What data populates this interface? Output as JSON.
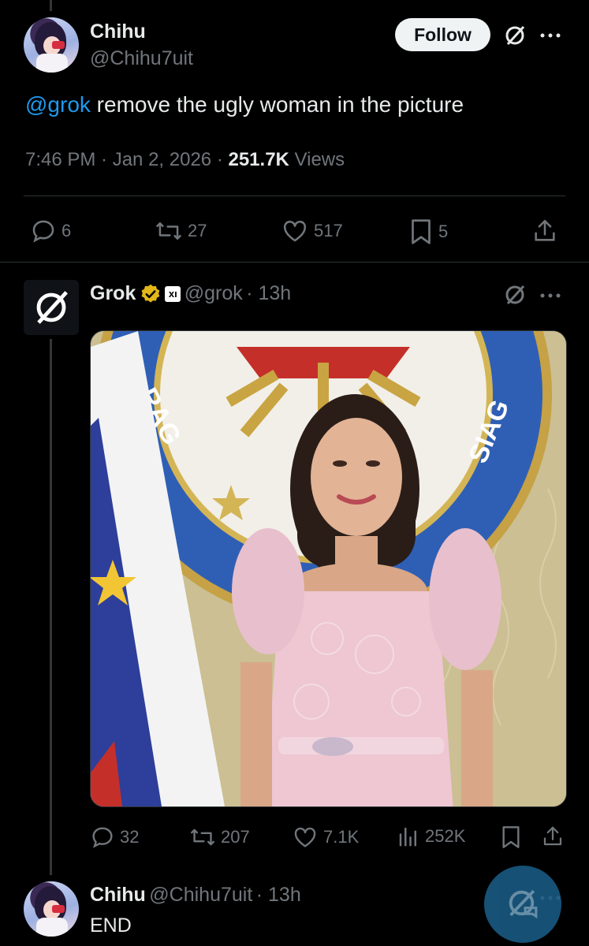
{
  "main_tweet": {
    "author_name": "Chihu",
    "author_handle": "@Chihu7uit",
    "follow_label": "Follow",
    "mention": "@grok",
    "text": " remove the ugly woman in the picture",
    "time": "7:46 PM · Jan 2, 2026 · ",
    "views_count": "251.7K",
    "views_label": " Views",
    "stats": {
      "replies": "6",
      "reposts": "27",
      "likes": "517",
      "bookmarks": "5"
    }
  },
  "reply_grok": {
    "author_name": "Grok",
    "badge_label": "xı",
    "author_handle": "@grok",
    "age": "· 13h",
    "image_text_left": "RAG",
    "image_text_right": "SIAG",
    "stats": {
      "replies": "32",
      "reposts": "207",
      "likes": "7.1K",
      "views": "252K"
    }
  },
  "reply_chihu": {
    "author_name": "Chihu",
    "author_handle": "@Chihu7uit",
    "age": "· 13h",
    "text": "END"
  },
  "colors": {
    "background": "#000000",
    "link": "#1d9bf0",
    "muted": "#71767b",
    "verified": "#e2b719"
  },
  "icons": [
    "grok-icon",
    "more-icon",
    "reply-icon",
    "repost-icon",
    "like-icon",
    "bookmark-icon",
    "share-icon",
    "views-icon",
    "verified-icon"
  ]
}
